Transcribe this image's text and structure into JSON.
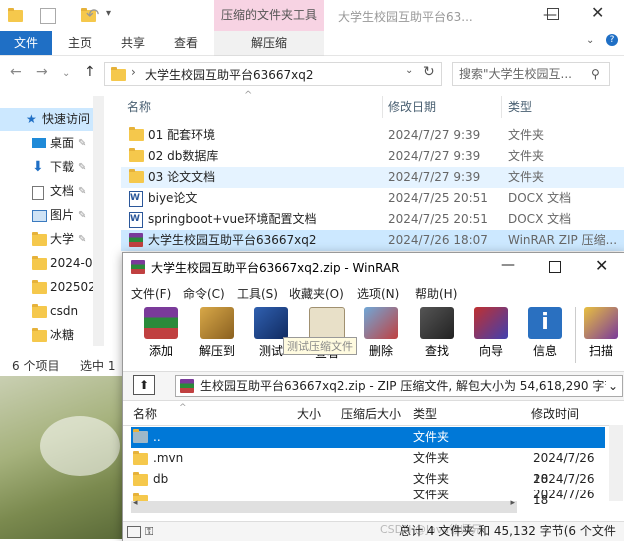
{
  "explorer": {
    "context_tab": "压缩的文件夹工具",
    "context_subtab": "解压缩",
    "window_title": "大学生校园互助平台63...",
    "tabs": [
      "文件",
      "主页",
      "共享",
      "查看"
    ],
    "breadcrumb": "大学生校园互助平台63667xq2",
    "search_placeholder": "搜索\"大学生校园互...",
    "columns": {
      "name": "名称",
      "date": "修改日期",
      "type": "类型"
    },
    "nav_items": [
      {
        "label": "快速访问",
        "icon": "star-icon"
      },
      {
        "label": "桌面",
        "icon": "desktop-icon"
      },
      {
        "label": "下载",
        "icon": "download-icon"
      },
      {
        "label": "文档",
        "icon": "document-icon"
      },
      {
        "label": "图片",
        "icon": "picture-icon"
      },
      {
        "label": "大学",
        "icon": "folder-icon"
      },
      {
        "label": "2024-0",
        "icon": "folder-icon"
      },
      {
        "label": "202502",
        "icon": "folder-icon"
      },
      {
        "label": "csdn",
        "icon": "folder-icon"
      },
      {
        "label": "冰糖",
        "icon": "folder-icon"
      }
    ],
    "files": [
      {
        "name": "01 配套环境",
        "date": "2024/7/27 9:39",
        "type": "文件夹",
        "icon": "folder-icon"
      },
      {
        "name": "02 db数据库",
        "date": "2024/7/27 9:39",
        "type": "文件夹",
        "icon": "folder-icon"
      },
      {
        "name": "03 论文文档",
        "date": "2024/7/27 9:39",
        "type": "文件夹",
        "icon": "folder-icon"
      },
      {
        "name": "biye论文",
        "date": "2024/7/25 20:51",
        "type": "DOCX 文档",
        "icon": "word-icon"
      },
      {
        "name": "springboot+vue环境配置文档",
        "date": "2024/7/25 20:51",
        "type": "DOCX 文档",
        "icon": "word-icon"
      },
      {
        "name": "大学生校园互助平台63667xq2",
        "date": "2024/7/26 18:07",
        "type": "WinRAR ZIP 压缩...",
        "icon": "rar-icon"
      }
    ],
    "status": {
      "count": "6 个项目",
      "selected": "选中 1"
    }
  },
  "winrar": {
    "title": "大学生校园互助平台63667xq2.zip - WinRAR",
    "menu": [
      "文件(F)",
      "命令(C)",
      "工具(S)",
      "收藏夹(O)",
      "选项(N)",
      "帮助(H)"
    ],
    "tools": [
      "添加",
      "解压到",
      "测试",
      "查看",
      "删除",
      "查找",
      "向导",
      "信息",
      "扫描"
    ],
    "tooltip": "测试压缩文件",
    "path": "生校园互助平台63667xq2.zip - ZIP 压缩文件, 解包大小为 54,618,290 字节",
    "columns": {
      "name": "名称",
      "size": "大小",
      "packed": "压缩后大小",
      "type": "类型",
      "modified": "修改时间"
    },
    "rows": [
      {
        "name": "..",
        "type": "文件夹",
        "modified": ""
      },
      {
        "name": ".mvn",
        "type": "文件夹",
        "modified": "2024/7/26 18"
      },
      {
        "name": "db",
        "type": "文件夹",
        "modified": "2024/7/26 18"
      },
      {
        "name": "",
        "type": "文件夹",
        "modified": "2024/7/26 18"
      }
    ],
    "status": "总计 4 文件夹 和 45,132 字节(6 个文件",
    "colors": {
      "selection": "#0078d7"
    }
  },
  "watermark": "CSDN @Java徐师兄"
}
